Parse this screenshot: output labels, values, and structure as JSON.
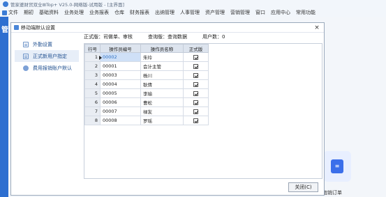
{
  "app": {
    "title": "管家婆财贸双全⊞Top+ V25.0-网络版-试用版 - [主界面]",
    "menu": [
      "文件",
      "期初",
      "基础资料",
      "业务处理",
      "业务报表",
      "仓库",
      "财务报表",
      "出纳管理",
      "人事管理",
      "资产管理",
      "营销管理",
      "窗口",
      "应用中心",
      "常用功能"
    ],
    "left_label": "管",
    "bg_card_label": "跑销订单"
  },
  "dialog": {
    "title": "移动端默认设置",
    "close_glyph": "×",
    "sidebar": [
      {
        "label": "外勤设置",
        "icon": "list-icon"
      },
      {
        "label": "正式新用户指定",
        "icon": "list-icon"
      },
      {
        "label": "费用报销账户默认",
        "icon": "dot-icon"
      }
    ],
    "info": {
      "formal": "正式版：司做单、审核",
      "query": "查询版：查询数据",
      "users": "用户数：0"
    },
    "table": {
      "headers": [
        "行号",
        "操作员编号",
        "操作员名称",
        "正式版"
      ],
      "rows": [
        {
          "no": "1",
          "code": "00002",
          "name": "朱玲",
          "checked": true
        },
        {
          "no": "2",
          "code": "00001",
          "name": "会计主管",
          "checked": true
        },
        {
          "no": "3",
          "code": "00003",
          "name": "杨川",
          "checked": true
        },
        {
          "no": "4",
          "code": "00004",
          "name": "耿倩",
          "checked": true
        },
        {
          "no": "5",
          "code": "00005",
          "name": "李瑜",
          "checked": true
        },
        {
          "no": "6",
          "code": "00006",
          "name": "曹松",
          "checked": true
        },
        {
          "no": "7",
          "code": "00007",
          "name": "禄友",
          "checked": true
        },
        {
          "no": "8",
          "code": "00008",
          "name": "罗瑶",
          "checked": true
        }
      ]
    },
    "close_button": "关闭(C)"
  }
}
